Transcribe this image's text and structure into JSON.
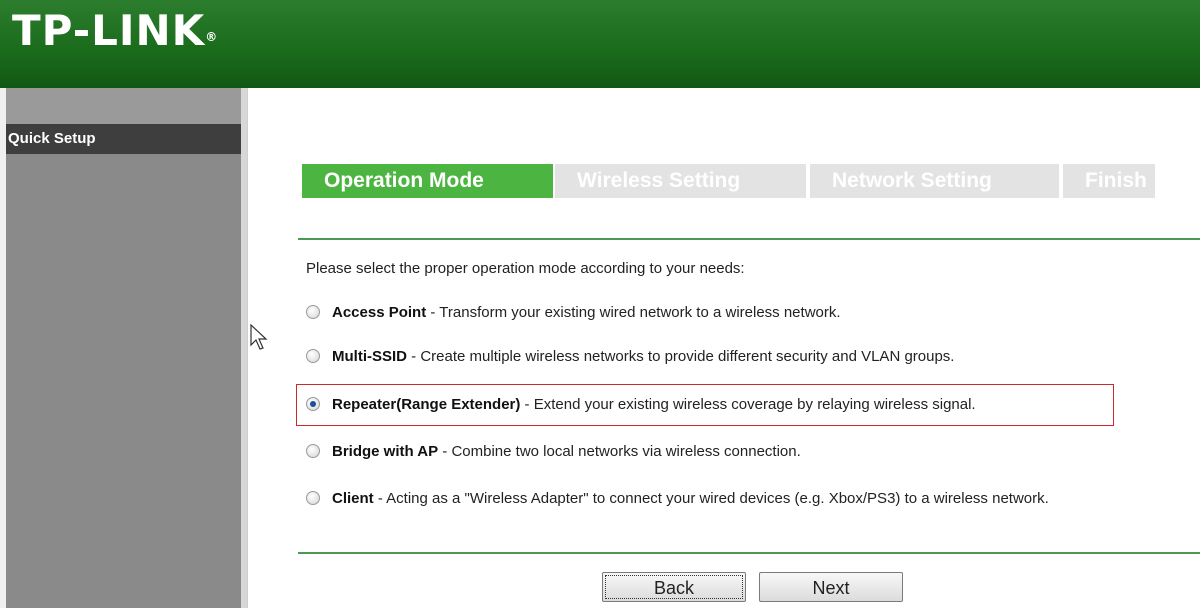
{
  "header": {
    "logo": "TP-LINK",
    "logo_mark": "®"
  },
  "sidebar": {
    "items": [
      {
        "label": "Quick Setup"
      }
    ]
  },
  "tabs": [
    {
      "label": "Operation Mode",
      "active": true
    },
    {
      "label": "Wireless Setting",
      "active": false
    },
    {
      "label": "Network Setting",
      "active": false
    },
    {
      "label": "Finish",
      "active": false
    }
  ],
  "intro": "Please select the proper operation mode according to your needs:",
  "options": [
    {
      "title": "Access Point",
      "desc": " - Transform your existing wired network to a wireless network.",
      "checked": false
    },
    {
      "title": "Multi-SSID",
      "desc": " - Create multiple wireless networks to provide different security and VLAN groups.",
      "checked": false
    },
    {
      "title": "Repeater(Range Extender)",
      "desc": " - Extend your existing wireless coverage by relaying wireless signal.",
      "checked": true
    },
    {
      "title": "Bridge with AP",
      "desc": " - Combine two local networks via wireless connection.",
      "checked": false
    },
    {
      "title": "Client",
      "desc": " - Acting as a \"Wireless Adapter\" to connect your wired devices (e.g. Xbox/PS3) to a wireless network.",
      "checked": false
    }
  ],
  "buttons": {
    "back": "Back",
    "next": "Next"
  },
  "colors": {
    "brand_green": "#1a6a1c",
    "active_tab": "#4cb542",
    "inactive_tab": "#e3e3e3",
    "highlight": "#cc2a2a"
  }
}
